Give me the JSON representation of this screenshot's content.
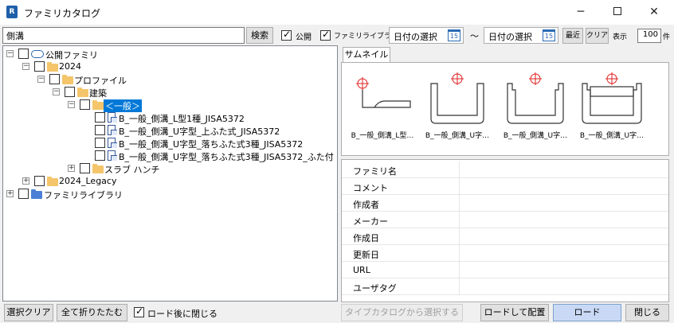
{
  "window": {
    "title": "ファミリカタログ",
    "app_icon": "R",
    "minimize_icon": "minimize-icon",
    "maximize_icon": "maximize-icon",
    "close_icon": "close-icon"
  },
  "search": {
    "value": "側溝",
    "button_label": "検索"
  },
  "filters": {
    "public_label": "公開",
    "public_checked": true,
    "library_label": "ファミリライブラリ",
    "library_checked": true,
    "date_from_placeholder": "日付の選択",
    "date_to_placeholder": "日付の選択",
    "calendar_number": "15",
    "range_separator": "～",
    "recent_label": "最近",
    "clear_label": "クリア",
    "display_label": "表示",
    "display_count": "100",
    "count_unit": "件"
  },
  "tree": {
    "root": "公開ファミリ",
    "year": "2024",
    "profile": "プロファイル",
    "arch": "建築",
    "general": "＜一般＞",
    "items": [
      "B_一般_側溝_L型1種_JISA5372",
      "B_一般_側溝_U字型_上ふた式_JISA5372",
      "B_一般_側溝_U字型_落ちふた式3種_JISA5372",
      "B_一般_側溝_U字型_落ちふた式3種_JISA5372_ふた付"
    ],
    "slab": "スラブ ハンチ",
    "legacy": "2024_Legacy",
    "library": "ファミリライブラリ"
  },
  "thumbnails": {
    "tab_label": "サムネイル",
    "items": [
      "B_一般_側溝_L型…",
      "B_一般_側溝_U字…",
      "B_一般_側溝_U字…",
      "B_一般_側溝_U字…"
    ]
  },
  "properties": {
    "rows": [
      "ファミリ名",
      "コメント",
      "作成者",
      "メーカー",
      "作成日",
      "更新日",
      "URL",
      "ユーザタグ"
    ]
  },
  "bottom": {
    "clear_selection": "選択クリア",
    "collapse_all": "全て折りたたむ",
    "close_after_load_label": "ロード後に閉じる",
    "close_after_load_checked": true,
    "select_from_type_catalog": "タイプカタログから選択する",
    "load_and_place": "ロードして配置",
    "load": "ロード",
    "close": "閉じる"
  },
  "colors": {
    "selection": "#0078d7",
    "load_button": "#c9d9f5",
    "folder": "#f4c56a",
    "library_folder": "#4a7fd6",
    "marker": "#e02020"
  }
}
